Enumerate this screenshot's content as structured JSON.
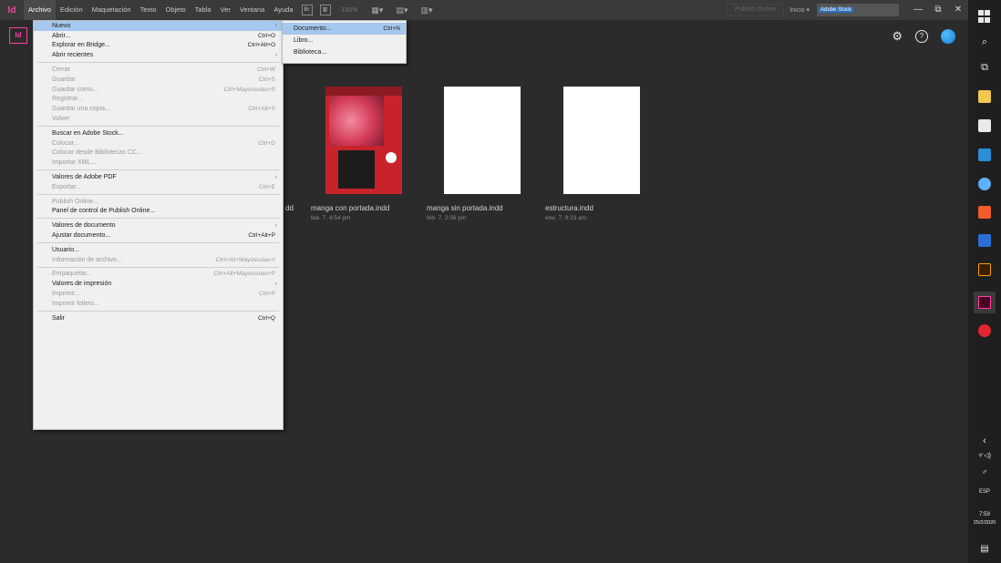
{
  "menubar": {
    "logo": "Id",
    "menus": [
      "Archivo",
      "Edición",
      "Maquetación",
      "Texto",
      "Objeto",
      "Tabla",
      "Ver",
      "Ventana",
      "Ayuda"
    ],
    "icon1": "Br",
    "icon2": "▥",
    "zoom": "100%",
    "tools": [
      "▦▾",
      "▤▾",
      "▥▾"
    ],
    "publish": "Publish Online",
    "inicio": "Inicio ▾",
    "search_tag": "Adobe Stock",
    "win_min": "—",
    "win_max": "⧉",
    "win_close": "✕"
  },
  "toolbar": {
    "badge": "Id",
    "help": "?"
  },
  "recent": [
    {
      "name": "manga con portada.indd",
      "date": "feb. 7, 4:54 pm"
    },
    {
      "name": "manga sin portada.indd",
      "date": "feb. 7, 2:56 pm"
    },
    {
      "name": "estructura.indd",
      "date": "ene. 7, 9:23 am"
    }
  ],
  "partial_suffix": "dd",
  "file_menu": {
    "items": [
      {
        "label": "Nuevo",
        "shortcut": "",
        "arrow": true,
        "disabled": false,
        "highlight": true
      },
      {
        "label": "Abrir...",
        "shortcut": "Ctrl+O",
        "disabled": false
      },
      {
        "label": "Explorar en Bridge...",
        "shortcut": "Ctrl+Alt+O",
        "disabled": false
      },
      {
        "label": "Abrir recientes",
        "shortcut": "",
        "arrow": true,
        "disabled": false
      },
      {
        "sep": true
      },
      {
        "label": "Cerrar",
        "shortcut": "Ctrl+W",
        "disabled": true
      },
      {
        "label": "Guardar",
        "shortcut": "Ctrl+S",
        "disabled": true
      },
      {
        "label": "Guardar como...",
        "shortcut": "Ctrl+Mayúsculas+S",
        "disabled": true
      },
      {
        "label": "Registrar...",
        "shortcut": "",
        "disabled": true
      },
      {
        "label": "Guardar una copia...",
        "shortcut": "Ctrl+Alt+S",
        "disabled": true
      },
      {
        "label": "Volver",
        "shortcut": "",
        "disabled": true
      },
      {
        "sep": true
      },
      {
        "label": "Buscar en Adobe Stock...",
        "shortcut": "",
        "disabled": false
      },
      {
        "label": "Colocar...",
        "shortcut": "Ctrl+D",
        "disabled": true
      },
      {
        "label": "Colocar desde Bibliotecas CC...",
        "shortcut": "",
        "disabled": true
      },
      {
        "label": "Importar XML...",
        "shortcut": "",
        "disabled": true
      },
      {
        "sep": true
      },
      {
        "label": "Valores de Adobe PDF",
        "shortcut": "",
        "arrow": true,
        "disabled": false
      },
      {
        "label": "Exportar...",
        "shortcut": "Ctrl+E",
        "disabled": true
      },
      {
        "sep": true
      },
      {
        "label": "Publish Online...",
        "shortcut": "",
        "disabled": true
      },
      {
        "label": "Panel de control de Publish Online...",
        "shortcut": "",
        "disabled": false
      },
      {
        "sep": true
      },
      {
        "label": "Valores de documento",
        "shortcut": "",
        "arrow": true,
        "disabled": false
      },
      {
        "label": "Ajustar documento...",
        "shortcut": "Ctrl+Alt+P",
        "disabled": false
      },
      {
        "sep": true
      },
      {
        "label": "Usuario...",
        "shortcut": "",
        "disabled": false
      },
      {
        "label": "Información de archivo...",
        "shortcut": "Ctrl+Alt+Mayúsculas+I",
        "disabled": true
      },
      {
        "sep": true
      },
      {
        "label": "Empaquetar...",
        "shortcut": "Ctrl+Alt+Mayúsculas+P",
        "disabled": true
      },
      {
        "label": "Valores de impresión",
        "shortcut": "",
        "arrow": true,
        "disabled": false
      },
      {
        "label": "Imprimir...",
        "shortcut": "Ctrl+P",
        "disabled": true
      },
      {
        "label": "Imprimir folleto...",
        "shortcut": "",
        "disabled": true
      },
      {
        "sep": true
      },
      {
        "label": "Salir",
        "shortcut": "Ctrl+Q",
        "disabled": false
      }
    ]
  },
  "submenu": {
    "items": [
      {
        "label": "Documento...",
        "shortcut": "Ctrl+N",
        "highlight": true
      },
      {
        "label": "Libro...",
        "shortcut": ""
      },
      {
        "label": "Biblioteca...",
        "shortcut": ""
      }
    ]
  },
  "taskbar": {
    "search": "⌕",
    "taskview": "⧉",
    "chevron": "‹",
    "tray": "⁴⁄ ◁)",
    "pen": "♂",
    "lang": "ESP",
    "time": "7:59",
    "date": "25/2/2020",
    "notify": "▤"
  }
}
